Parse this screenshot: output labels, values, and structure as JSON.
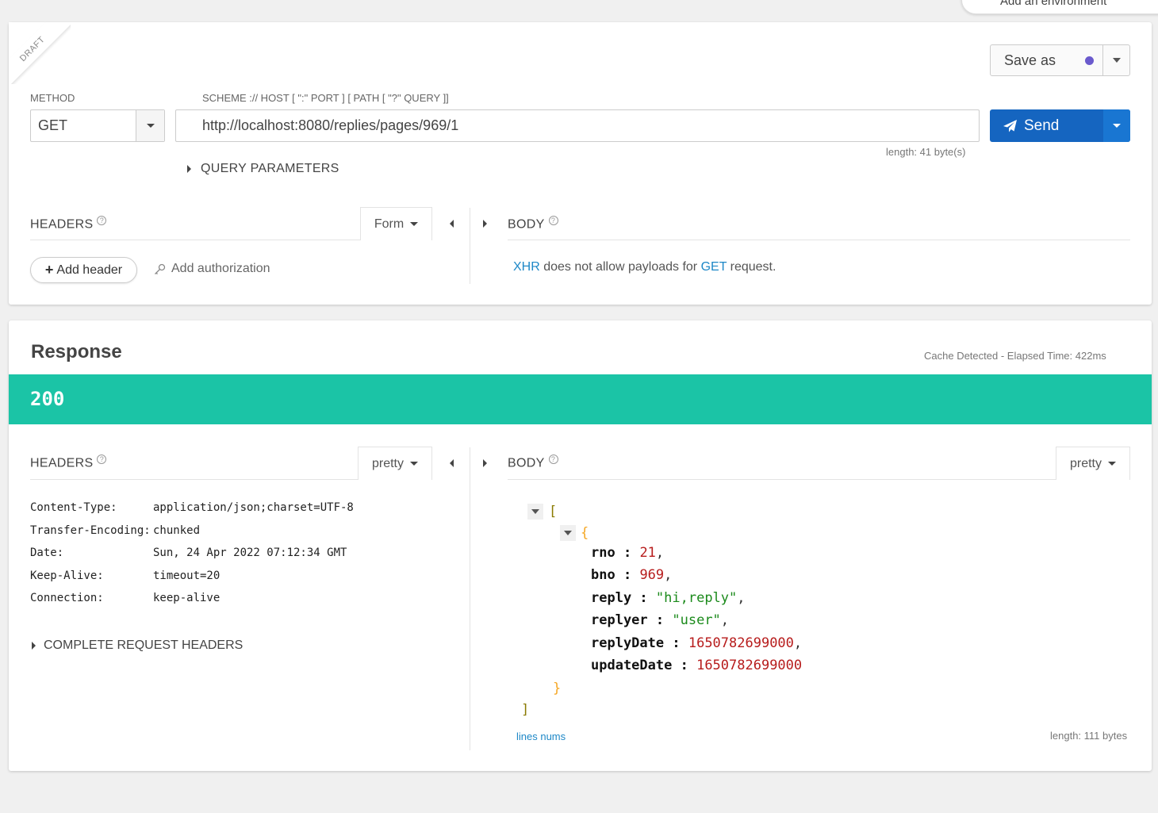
{
  "environment": {
    "label": "Add an environment"
  },
  "request": {
    "draft_label": "DRAFT",
    "method_label": "METHOD",
    "method_value": "GET",
    "url_label": "SCHEME :// HOST [ \":\" PORT ] [ PATH [ \"?\" QUERY ]]",
    "url_value": "http://localhost:8080/replies/pages/969/1",
    "url_length": "length: 41 byte(s)",
    "save_as_label": "Save as",
    "send_label": "Send",
    "query_params_label": "QUERY PARAMETERS",
    "headers_title": "HEADERS",
    "headers_mode": "Form",
    "add_header_label": "Add header",
    "add_authorization_label": "Add authorization",
    "body_title": "BODY",
    "body_message": {
      "kw1": "XHR",
      "mid": " does not allow payloads for ",
      "kw2": "GET",
      "end": " request."
    }
  },
  "response": {
    "title": "Response",
    "elapsed": "Cache Detected - Elapsed Time: 422ms",
    "status_code": "200",
    "headers_title": "HEADERS",
    "headers_mode": "pretty",
    "body_title": "BODY",
    "body_mode": "pretty",
    "headers": [
      {
        "key": "Content-Type:",
        "value": "application/json;charset=UTF-8"
      },
      {
        "key": "Transfer-Encoding:",
        "value": "chunked"
      },
      {
        "key": "Date:",
        "value": "Sun, 24 Apr 2022 07:12:34 GMT"
      },
      {
        "key": "Keep-Alive:",
        "value": "timeout=20"
      },
      {
        "key": "Connection:",
        "value": "keep-alive"
      }
    ],
    "complete_request_headers_label": "COMPLETE REQUEST HEADERS",
    "json_body": {
      "open_bracket": "[",
      "close_bracket": "]",
      "open_brace": "{",
      "close_brace": "}",
      "fields": [
        {
          "key": "rno",
          "value": "21",
          "type": "number",
          "comma": ","
        },
        {
          "key": "bno",
          "value": "969",
          "type": "number",
          "comma": ","
        },
        {
          "key": "reply",
          "value": "\"hi,reply\"",
          "type": "string",
          "comma": ","
        },
        {
          "key": "replyer",
          "value": "\"user\"",
          "type": "string",
          "comma": ","
        },
        {
          "key": "replyDate",
          "value": "1650782699000",
          "type": "number",
          "comma": ","
        },
        {
          "key": "updateDate",
          "value": "1650782699000",
          "type": "number",
          "comma": ""
        }
      ]
    },
    "lines_nums_label": "lines nums",
    "body_length": "length: 111 bytes"
  },
  "colors": {
    "status_bar": "#1bc4a6",
    "send_button": "#1565c0",
    "link": "#1e88c7",
    "save_dot": "#6a5acd"
  }
}
